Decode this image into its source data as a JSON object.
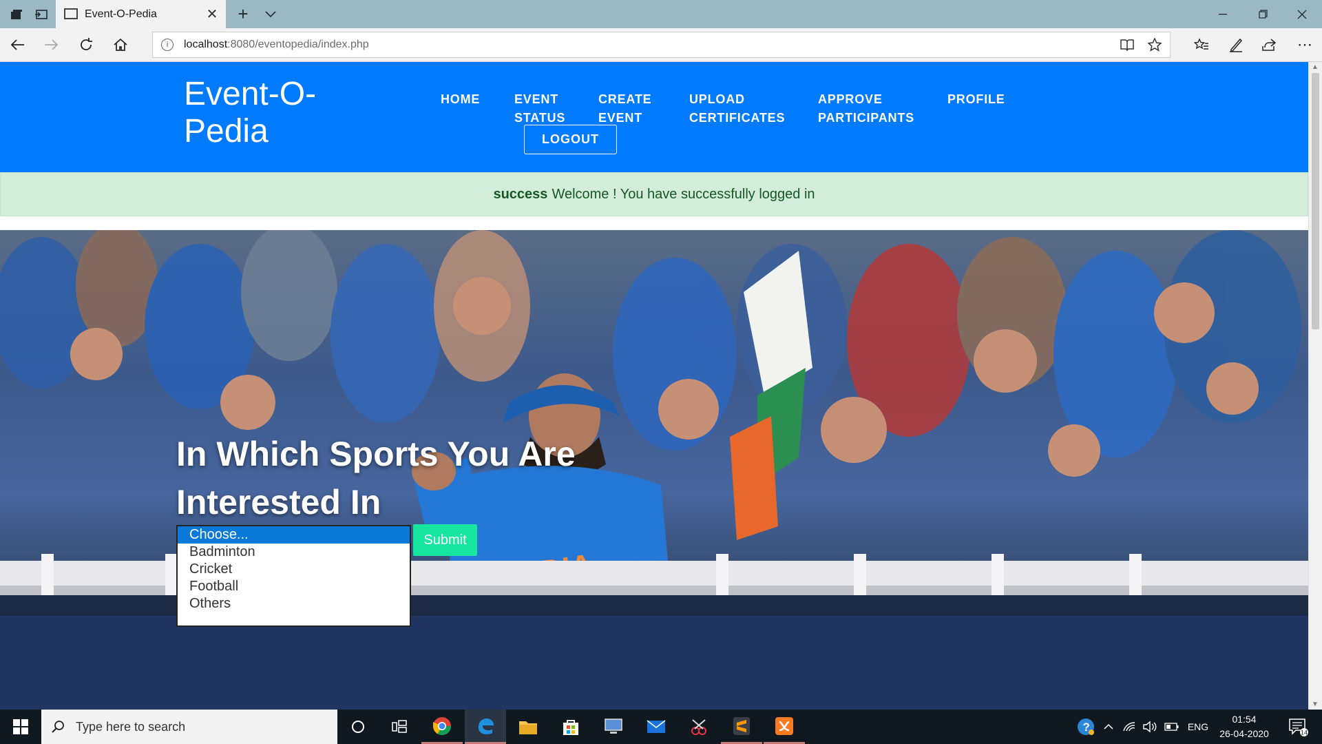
{
  "browser": {
    "tab_title": "Event-O-Pedia",
    "url_host": "localhost",
    "url_rest": ":8080/eventopedia/index.php"
  },
  "site": {
    "brand": "Event-O-Pedia",
    "nav": [
      {
        "line1": "HOME",
        "line2": ""
      },
      {
        "line1": "EVENT",
        "line2": "STATUS"
      },
      {
        "line1": "CREATE",
        "line2": "EVENT"
      },
      {
        "line1": "UPLOAD",
        "line2": "CERTIFICATES"
      },
      {
        "line1": "APPROVE",
        "line2": "PARTICIPANTS"
      },
      {
        "line1": "PROFILE",
        "line2": ""
      }
    ],
    "logout_label": "LOGOUT",
    "alert": {
      "strong": "success",
      "message": "Welcome ! You have successfully logged in"
    },
    "hero": {
      "title": "In Which Sports You Are Interested In",
      "options": [
        "Choose...",
        "Badminton",
        "Cricket",
        "Football",
        "Others"
      ],
      "selected_option": "Choose...",
      "submit_label": "Submit",
      "jersey_text": "INDIA"
    },
    "colors": {
      "header": "#007bff",
      "alert_bg": "#d4edda",
      "submit": "#17e6a1",
      "selected_option": "#0a78d7"
    }
  },
  "taskbar": {
    "search_placeholder": "Type here to search",
    "language": "ENG",
    "time": "01:54",
    "date": "26-04-2020",
    "notification_count": "14"
  }
}
